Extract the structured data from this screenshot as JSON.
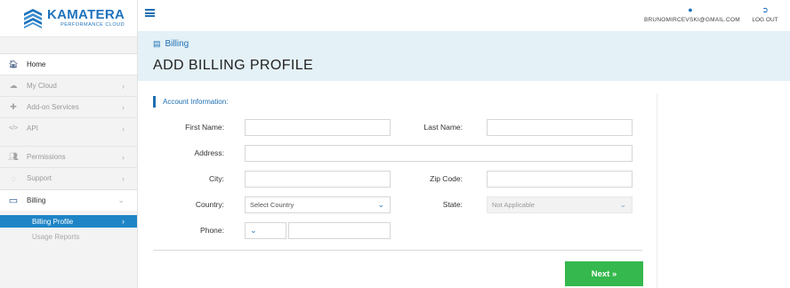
{
  "brand": {
    "name": "KAMATERA",
    "tagline": "PERFORMANCE CLOUD",
    "color": "#1e73be"
  },
  "topbar": {
    "menu_icon": "hamburger-icon",
    "user_icon": "user-icon",
    "user_email": "BRUNOMIRCEVSKI@GMAIL.COM",
    "logout_icon": "sign-out-icon",
    "logout_label": "LOG OUT"
  },
  "sidebar": {
    "items": [
      {
        "label": "Home",
        "icon": "home-icon",
        "glyph": "🏠︎",
        "chevron": ""
      },
      {
        "label": "My Cloud",
        "icon": "cloud-icon",
        "glyph": "☁",
        "chevron": "›"
      },
      {
        "label": "Add-on Services",
        "icon": "puzzle-icon",
        "glyph": "✚",
        "chevron": "›"
      },
      {
        "label": "API",
        "icon": "code-icon",
        "glyph": "</>",
        "chevron": "›"
      },
      {
        "label": "Permissions",
        "icon": "users-icon",
        "glyph": "👥︎",
        "chevron": "›"
      },
      {
        "label": "Support",
        "icon": "support-icon",
        "glyph": "◌",
        "chevron": "›"
      },
      {
        "label": "Billing",
        "icon": "credit-card-icon",
        "glyph": "▭",
        "chevron": "⌄"
      }
    ],
    "subitems": [
      {
        "label": "Billing Profile",
        "chevron": "›"
      },
      {
        "label": "Usage Reports"
      }
    ]
  },
  "header": {
    "breadcrumb_icon": "credit-card-icon",
    "breadcrumb": "Billing",
    "title": "ADD BILLING PROFILE"
  },
  "form": {
    "section_title": "Account Information:",
    "first_name": {
      "label": "First Name:",
      "value": ""
    },
    "last_name": {
      "label": "Last Name:",
      "value": ""
    },
    "address": {
      "label": "Address:",
      "value": ""
    },
    "city": {
      "label": "City:",
      "value": ""
    },
    "zip": {
      "label": "Zip Code:",
      "value": ""
    },
    "country": {
      "label": "Country:",
      "selected": "Select Country"
    },
    "state": {
      "label": "State:",
      "selected": "Not Applicable"
    },
    "phone": {
      "label": "Phone:",
      "code_selected": "",
      "value": ""
    },
    "next_label": "Next »"
  },
  "colors": {
    "accent": "#1e84c6",
    "next_button": "#35b84d",
    "header_bg": "#e4f1f7"
  }
}
